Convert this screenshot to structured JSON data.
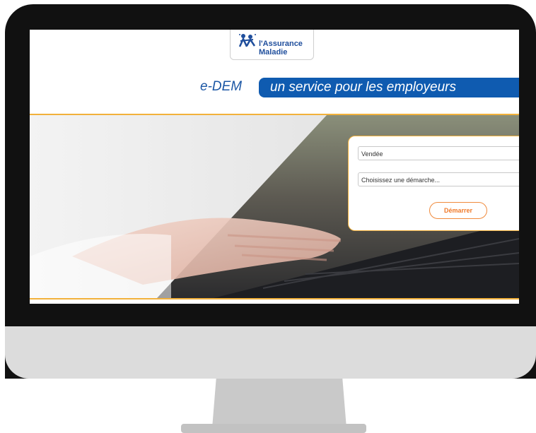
{
  "header": {
    "logo_line1": "l'Assurance",
    "logo_line2": "Maladie"
  },
  "service": {
    "brand": "e-DEM",
    "tagline": "un service pour les employeurs"
  },
  "form": {
    "department_value": "Vendée",
    "demarche_value": "Choisissez une démarche...",
    "start_label": "Démarrer"
  },
  "colors": {
    "brand_blue": "#0f5bb0",
    "accent_orange": "#f2b13b",
    "button_orange": "#f07a2a"
  }
}
